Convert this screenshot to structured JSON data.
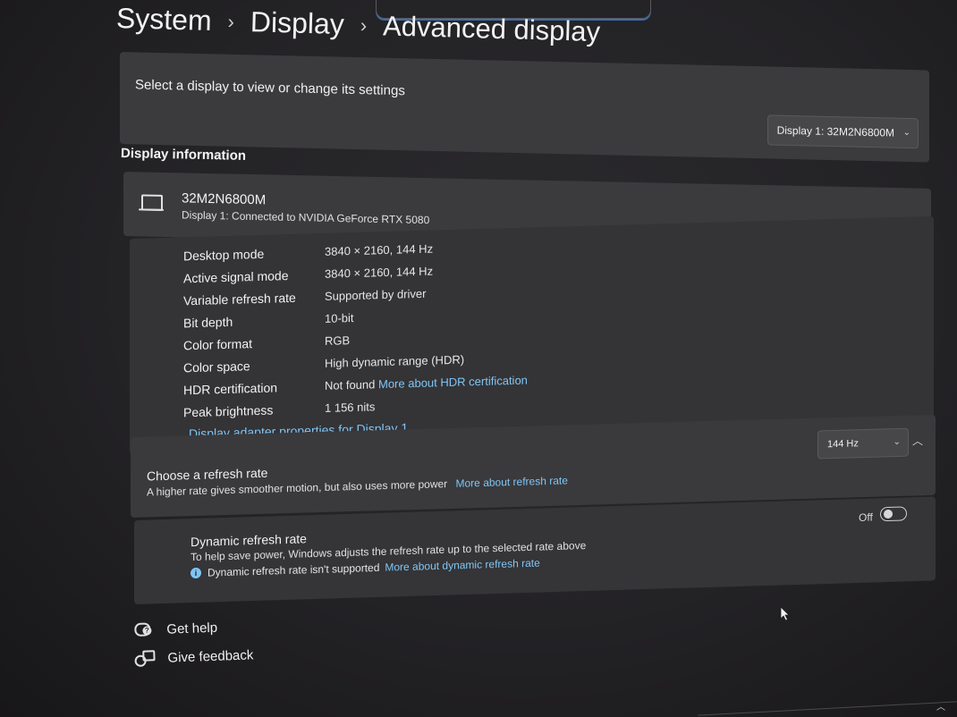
{
  "breadcrumb": {
    "items": [
      "System",
      "Display",
      "Advanced display"
    ],
    "separator": "›"
  },
  "select_display": {
    "label": "Select a display to view or change its settings",
    "selected": "Display 1: 32M2N6800M"
  },
  "display_information": {
    "section_title": "Display information",
    "monitor_name": "32M2N6800M",
    "connection": "Display 1: Connected to NVIDIA GeForce RTX 5080",
    "rows": [
      {
        "label": "Desktop mode",
        "value": "3840 × 2160, 144 Hz"
      },
      {
        "label": "Active signal mode",
        "value": "3840 × 2160, 144 Hz"
      },
      {
        "label": "Variable refresh rate",
        "value": "Supported by driver"
      },
      {
        "label": "Bit depth",
        "value": "10-bit"
      },
      {
        "label": "Color format",
        "value": "RGB"
      },
      {
        "label": "Color space",
        "value": "High dynamic range (HDR)"
      },
      {
        "label": "HDR certification",
        "value": "Not found",
        "link": "More about HDR certification"
      },
      {
        "label": "Peak brightness",
        "value": "1 156 nits"
      }
    ],
    "adapter_link": "Display adapter properties for Display 1"
  },
  "refresh_rate": {
    "title": "Choose a refresh rate",
    "description": "A higher rate gives smoother motion, but also uses more power",
    "link": "More about refresh rate",
    "selected": "144 Hz"
  },
  "dynamic_refresh": {
    "title": "Dynamic refresh rate",
    "description": "To help save power, Windows adjusts the refresh rate up to the selected rate above",
    "note": "Dynamic refresh rate isn't supported",
    "link": "More about dynamic refresh rate",
    "state": "Off"
  },
  "help_links": {
    "get_help": "Get help",
    "give_feedback": "Give feedback"
  },
  "colors": {
    "accent_link": "#7fc6f5",
    "card_bg": "#3a393c",
    "page_bg": "#232225"
  }
}
